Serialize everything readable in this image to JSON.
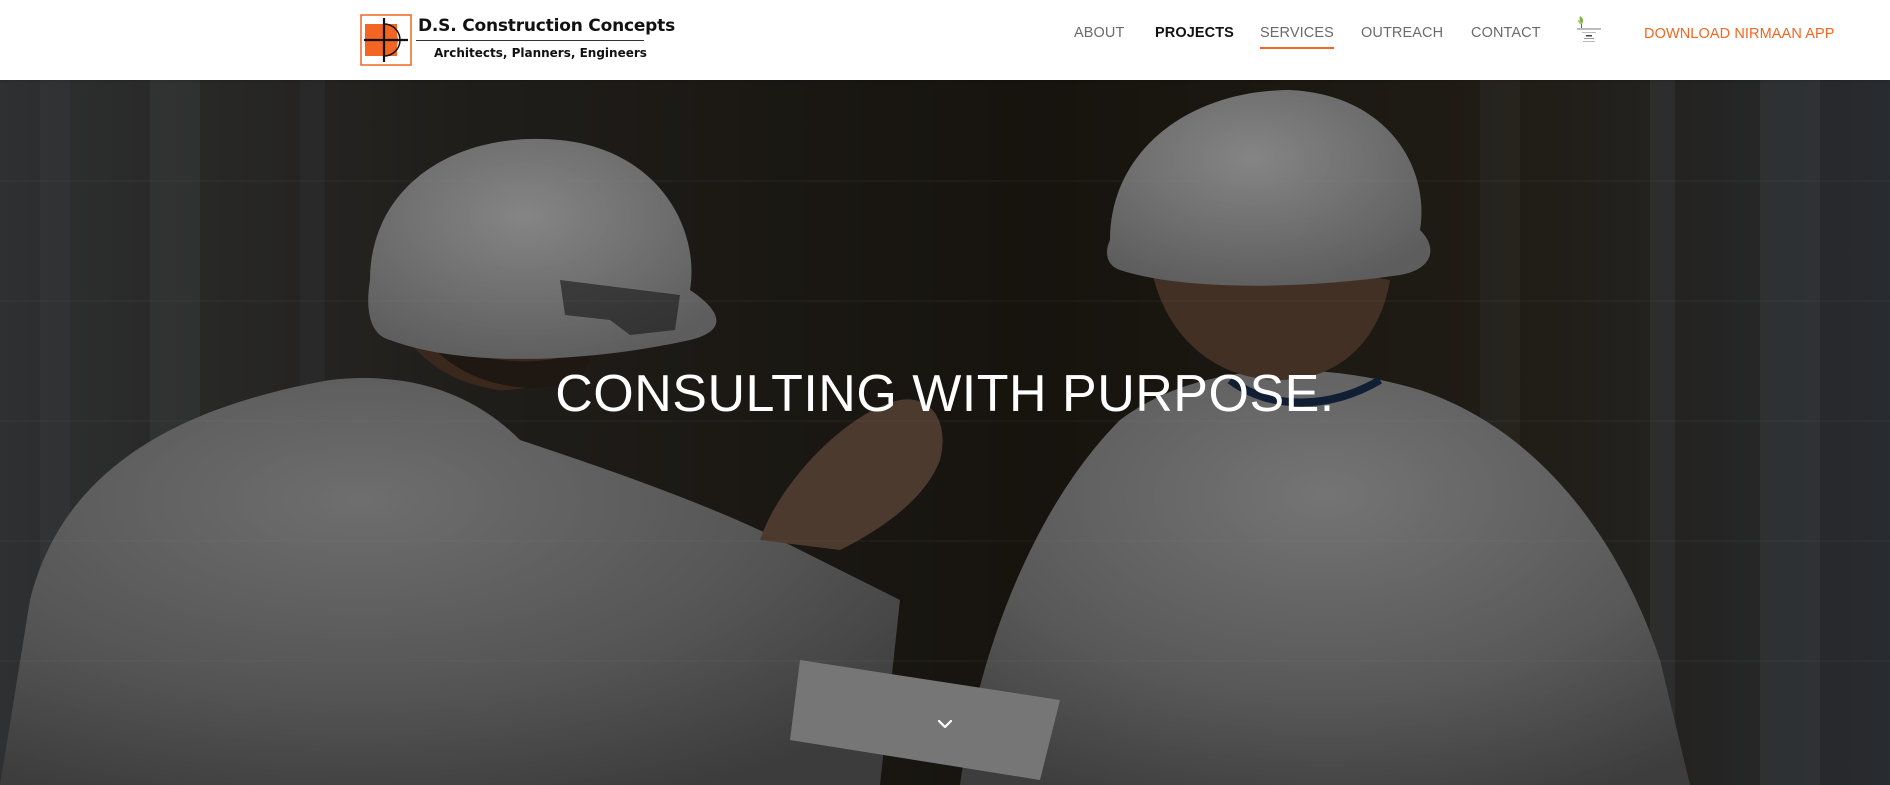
{
  "brand": {
    "name": "D.S. Construction Concepts",
    "tagline": "Architects, Planners, Engineers",
    "accent_color": "#f26522"
  },
  "nav": {
    "items": [
      {
        "label": "ABOUT"
      },
      {
        "label": "PROJECTS"
      },
      {
        "label": "SERVICES"
      },
      {
        "label": "OUTREACH"
      },
      {
        "label": "CONTACT"
      }
    ],
    "partner_icon": "nirmaan-logo-icon",
    "cta_label": "DOWNLOAD NIRMAAN APP"
  },
  "hero": {
    "title": "CONSULTING WITH PURPOSE.",
    "scroll_icon": "chevron-down-icon"
  }
}
